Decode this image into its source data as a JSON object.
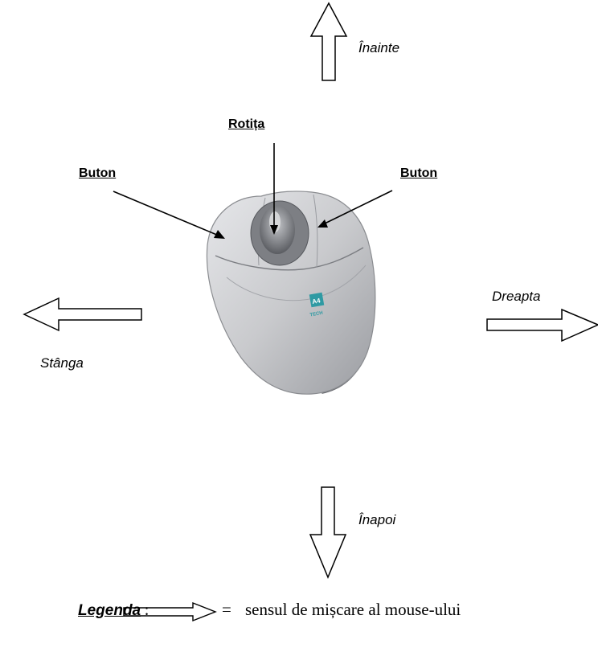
{
  "labels": {
    "forward": "Înainte",
    "backward": "Înapoi",
    "left": "Stânga",
    "right": "Dreapta",
    "wheel": "Rotița",
    "button_left": "Buton",
    "button_right": "Buton"
  },
  "mouse_logo": {
    "top": "A4",
    "bottom": "TECH"
  },
  "legend": {
    "title": "Legenda",
    "colon": ":",
    "equals": "=",
    "description": "sensul de mișcare al mouse-ului"
  },
  "colors": {
    "mouse_body": "#c9cacd",
    "mouse_shadow": "#6e7076",
    "logo": "#2f9aa3"
  }
}
